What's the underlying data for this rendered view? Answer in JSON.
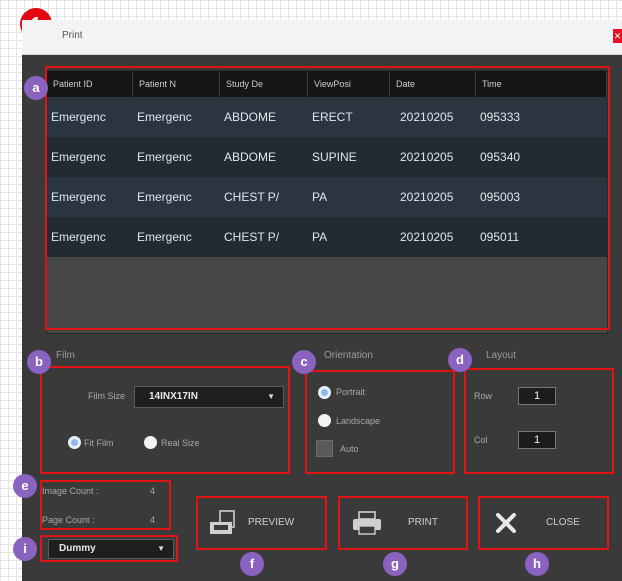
{
  "step_number": "1",
  "window": {
    "title": "Print"
  },
  "grid": {
    "columns": [
      "Patient ID",
      "Patient N",
      "Study De",
      "ViewPosi",
      "Date",
      "Time"
    ],
    "rows": [
      [
        "Emergenc",
        "Emergenc",
        "ABDOME",
        "ERECT",
        "20210205",
        "095333"
      ],
      [
        "Emergenc",
        "Emergenc",
        "ABDOME",
        "SUPINE",
        "20210205",
        "095340"
      ],
      [
        "Emergenc",
        "Emergenc",
        "CHEST P/",
        "PA",
        "20210205",
        "095003"
      ],
      [
        "Emergenc",
        "Emergenc",
        "CHEST P/",
        "PA",
        "20210205",
        "095011"
      ]
    ]
  },
  "film": {
    "title": "Film",
    "size_label": "Film Size",
    "size_value": "14INX17IN",
    "fit_label": "Fit Film",
    "real_label": "Real Size",
    "selected": "fit"
  },
  "orientation": {
    "title": "Orientation",
    "portrait_label": "Portrait",
    "landscape_label": "Landscape",
    "auto_label": "Auto",
    "selected": "portrait"
  },
  "layout": {
    "title": "Layout",
    "row_label": "Row",
    "row_value": "1",
    "col_label": "Col",
    "col_value": "1"
  },
  "counts": {
    "image_label": "Image Count :",
    "image_value": "4",
    "page_label": "Page Count :",
    "page_value": "4"
  },
  "printer": {
    "value": "Dummy"
  },
  "buttons": {
    "preview": "PREVIEW",
    "print": "PRINT",
    "close": "CLOSE"
  },
  "markers": [
    "a",
    "b",
    "c",
    "d",
    "e",
    "f",
    "g",
    "h",
    "i"
  ],
  "colors": {
    "highlight": "#e01414",
    "marker": "#8a62bf",
    "step": "#e30613"
  },
  "icons": [
    "preview-icon",
    "printer-icon",
    "close-x-icon",
    "dropdown-arrow-icon"
  ]
}
